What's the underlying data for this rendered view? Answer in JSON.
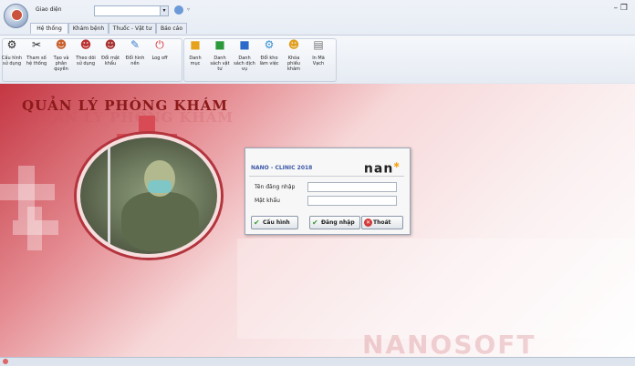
{
  "titlebar": {
    "quick_access_label": "Giao diện",
    "window_controls": "– ❐"
  },
  "ribbon_tabs": [
    {
      "label": "Hệ thống"
    },
    {
      "label": "Khám bệnh"
    },
    {
      "label": "Thuốc - Vật tư"
    },
    {
      "label": "Báo cáo"
    }
  ],
  "ribbon_buttons": [
    {
      "label": "Cấu hình sử dụng",
      "icon": "gear-icon"
    },
    {
      "label": "Tham số hệ thống",
      "icon": "tools-icon"
    },
    {
      "label": "Tạo và phân quyền",
      "icon": "user-add-icon"
    },
    {
      "label": "Theo dõi sử dụng",
      "icon": "user-watch-icon"
    },
    {
      "label": "Đổi mật khẩu",
      "icon": "user-key-icon"
    },
    {
      "label": "Đổi hình nền",
      "icon": "paint-icon"
    },
    {
      "label": "Log off",
      "icon": "power-icon"
    },
    {
      "label": "Danh mục",
      "icon": "book-icon"
    },
    {
      "label": "Danh sách vật tư",
      "icon": "book-icon"
    },
    {
      "label": "Danh sách dịch vụ",
      "icon": "book-icon"
    },
    {
      "label": "Đổi kho làm việc",
      "icon": "warehouse-icon"
    },
    {
      "label": "Khóa phiếu khám",
      "icon": "lock-icon"
    },
    {
      "label": "In Mã Vạch",
      "icon": "barcode-icon"
    }
  ],
  "main": {
    "title": "QUẢN LÝ PHÒNG KHÁM",
    "watermark": "NANOSOFT"
  },
  "login": {
    "product": "NANO - CLINIC 2018",
    "logo_text": "nan",
    "username_label": "Tên đăng nhập",
    "password_label": "Mật khẩu",
    "username_value": "",
    "password_value": "",
    "config_button": "Cấu hình",
    "login_button": "Đăng nhập",
    "exit_button": "Thoát"
  },
  "colors": {
    "accent": "#c43642",
    "brand_blue": "#3a57a8"
  }
}
